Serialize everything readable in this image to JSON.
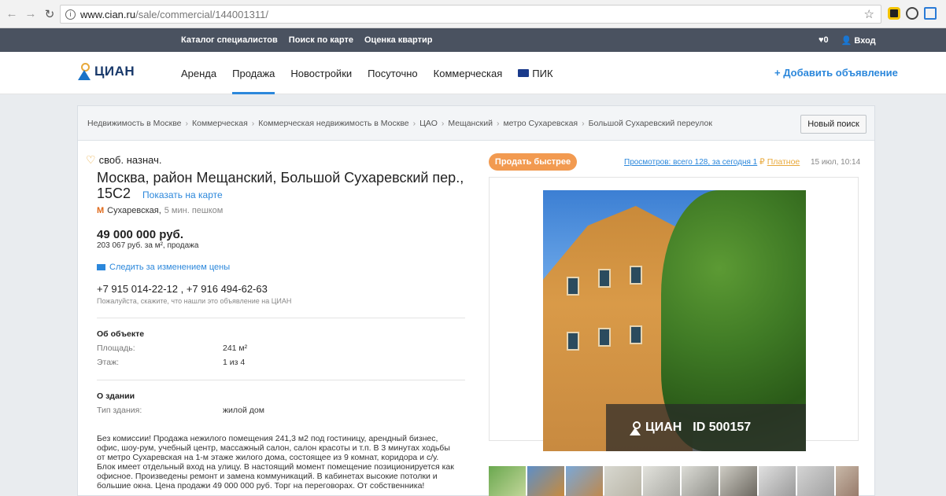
{
  "browser": {
    "url_host": "www.cian.ru",
    "url_path": "/sale/commercial/144001311/"
  },
  "topbar": {
    "links": [
      "Каталог специалистов",
      "Поиск по карте",
      "Оценка квартир"
    ],
    "favorites_count": "0",
    "login": "Вход"
  },
  "mainnav": {
    "logo": "ЦИАН",
    "items": [
      "Аренда",
      "Продажа",
      "Новостройки",
      "Посуточно",
      "Коммерческая"
    ],
    "pik": "ПИК",
    "add_listing": "+ Добавить объявление"
  },
  "breadcrumbs": [
    "Недвижимость в Москве",
    "Коммерческая",
    "Коммерческая недвижимость в Москве",
    "ЦАО",
    "Мещанский",
    "метро Сухаревская",
    "Большой Сухаревский переулок"
  ],
  "new_search": "Новый поиск",
  "listing": {
    "type": "своб. назнач.",
    "title_line1": "Москва, район Мещанский, Большой Сухаревский пер.,",
    "title_line2": "15С2",
    "show_on_map": "Показать на карте",
    "metro_station": "Сухаревская,",
    "metro_walk": "5 мин. пешком",
    "price": "49 000 000 руб.",
    "price_per_m2": "203 067 руб. за м², продажа",
    "follow_price": "Следить за изменением цены",
    "phones": "+7 915 014-22-12 , +7 916 494-62-63",
    "phones_note": "Пожалуйста, скажите, что нашли это объявление на ЦИАН",
    "about_object": "Об объекте",
    "area_label": "Площадь:",
    "area_value": "241 м²",
    "floor_label": "Этаж:",
    "floor_value": "1 из 4",
    "about_building": "О здании",
    "building_type_label": "Тип здания:",
    "building_type_value": "жилой дом",
    "description": "Без комиссии! Продажа нежилого помещения 241,3 м2 под гостиницу, арендный бизнес, офис, шоу-рум, учебный центр, массажный салон, салон красоты и т.п. В 3 минутах ходьбы от метро Сухаревская на 1-м этаже жилого дома, состоящее из 9 комнат, коридора и с/у. Блок имеет отдельный вход на улицу. В настоящий момент помещение позиционируется как офисное. Произведены ремонт и замена коммуникаций. В кабинетах высокие потолки и большие окна. Цена продажи 49 000 000 руб. Торг на переговорах. От собственника!"
  },
  "side": {
    "sell_faster": "Продать быстрее",
    "views": "Просмотров: всего 128, за сегодня 1",
    "paid": "Платное",
    "paid_symbol": "₽",
    "date": "15 июл, 10:14",
    "photo_logo": "ЦИАН",
    "photo_id": "ID 500157"
  },
  "colors": {
    "accent": "#2b87db",
    "orange": "#f29a50",
    "topbar": "#4a5260"
  }
}
